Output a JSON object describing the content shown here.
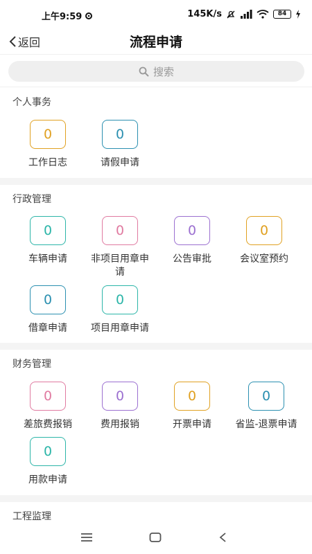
{
  "status_bar": {
    "time": "上午9:59",
    "network_speed": "145K/s",
    "battery": "84"
  },
  "nav": {
    "back_label": "返回",
    "title": "流程申请"
  },
  "search": {
    "placeholder": "搜索"
  },
  "sections": [
    {
      "title": "个人事务",
      "items": [
        {
          "label": "工作日志",
          "count": "0",
          "color": "#e0a020"
        },
        {
          "label": "请假申请",
          "count": "0",
          "color": "#2a8fb0"
        }
      ]
    },
    {
      "title": "行政管理",
      "items": [
        {
          "label": "车辆申请",
          "count": "0",
          "color": "#2bb5a8"
        },
        {
          "label": "非项目用章申请",
          "count": "0",
          "color": "#e07aa0"
        },
        {
          "label": "公告审批",
          "count": "0",
          "color": "#9b6fd0"
        },
        {
          "label": "会议室预约",
          "count": "0",
          "color": "#e0a020"
        },
        {
          "label": "借章申请",
          "count": "0",
          "color": "#2a8fb0"
        },
        {
          "label": "项目用章申请",
          "count": "0",
          "color": "#2bb5a8"
        }
      ]
    },
    {
      "title": "财务管理",
      "items": [
        {
          "label": "差旅费报销",
          "count": "0",
          "color": "#e07aa0"
        },
        {
          "label": "费用报销",
          "count": "0",
          "color": "#9b6fd0"
        },
        {
          "label": "开票申请",
          "count": "0",
          "color": "#e0a020"
        },
        {
          "label": "省监-退票申请",
          "count": "0",
          "color": "#2a8fb0"
        },
        {
          "label": "用款申请",
          "count": "0",
          "color": "#2bb5a8"
        }
      ]
    },
    {
      "title": "工程监理",
      "items": []
    }
  ]
}
